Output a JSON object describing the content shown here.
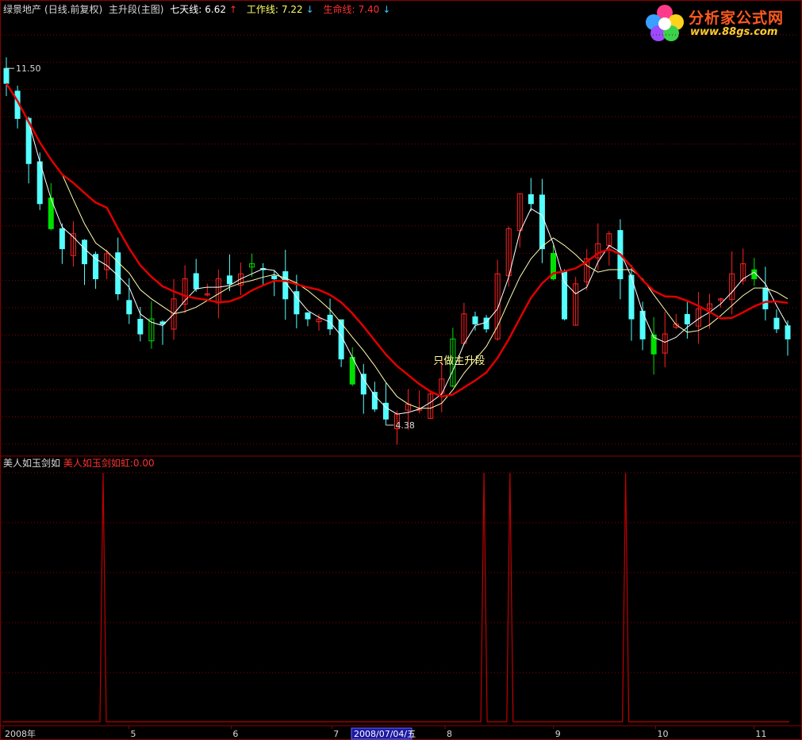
{
  "header": {
    "stock_name": "绿景地产",
    "period": "(日线.前复权)",
    "formula": "主升段(主图)",
    "ma7_label": "七天线:",
    "ma7_value": "6.62",
    "ma7_arrow": "↑",
    "work_label": "工作线:",
    "work_value": "7.22",
    "work_arrow": "↓",
    "life_label": "生命线:",
    "life_value": "7.40",
    "life_arrow": "↓"
  },
  "sub_header": {
    "name": "美人如玉剑如",
    "line_label": "美人如玉剑如虹:",
    "line_value": "0.00"
  },
  "logo": {
    "title": "分析家公式网",
    "url": "www.88gs.com"
  },
  "colors": {
    "background": "#000000",
    "grid": "#8b0000",
    "up_candle": "#ff2020",
    "down_candle": "#54ffff",
    "green_candle": "#00e000",
    "life_line": "#e00000",
    "work_line": "#ffffb0",
    "ma7_line": "#ffffff",
    "indicator": "#c00000"
  },
  "chart_data": {
    "type": "candlestick",
    "price_labels": {
      "high": "11.50",
      "low": "4.38"
    },
    "high_value": 11.5,
    "low_value": 4.38,
    "annotation": "只做主升段",
    "x_axis": {
      "labels": [
        "2008年",
        "5",
        "6",
        "7",
        "8",
        "9",
        "10",
        "11"
      ],
      "cursor_date": "2008/07/04/五"
    },
    "series": [
      {
        "name": "七天线",
        "last_value": 6.62
      },
      {
        "name": "工作线",
        "last_value": 7.22
      },
      {
        "name": "生命线",
        "last_value": 7.4
      }
    ],
    "close_path": [
      11.2,
      10.5,
      9.6,
      8.8,
      8.3,
      7.9,
      8.2,
      7.6,
      7.3,
      7.8,
      7.0,
      6.6,
      6.2,
      6.5,
      6.4,
      6.9,
      7.3,
      7.1,
      7.0,
      7.3,
      7.2,
      7.4,
      7.6,
      7.5,
      7.3,
      6.9,
      6.6,
      6.5,
      6.5,
      6.3,
      5.7,
      5.2,
      5.0,
      4.7,
      4.5,
      4.6,
      4.8,
      4.7,
      5.0,
      5.3,
      6.1,
      6.6,
      6.4,
      6.3,
      7.4,
      8.3,
      9.0,
      8.8,
      7.9,
      7.3,
      6.5,
      7.2,
      7.7,
      8.0,
      8.2,
      7.3,
      6.5,
      6.1,
      5.8,
      6.2,
      6.4,
      6.4,
      6.7,
      6.8,
      6.9,
      7.4,
      7.6,
      7.3,
      6.7,
      6.3,
      6.1
    ]
  },
  "indicator_data": {
    "spike_positions": [
      0.128,
      0.612,
      0.645,
      0.792
    ],
    "max": 1
  }
}
